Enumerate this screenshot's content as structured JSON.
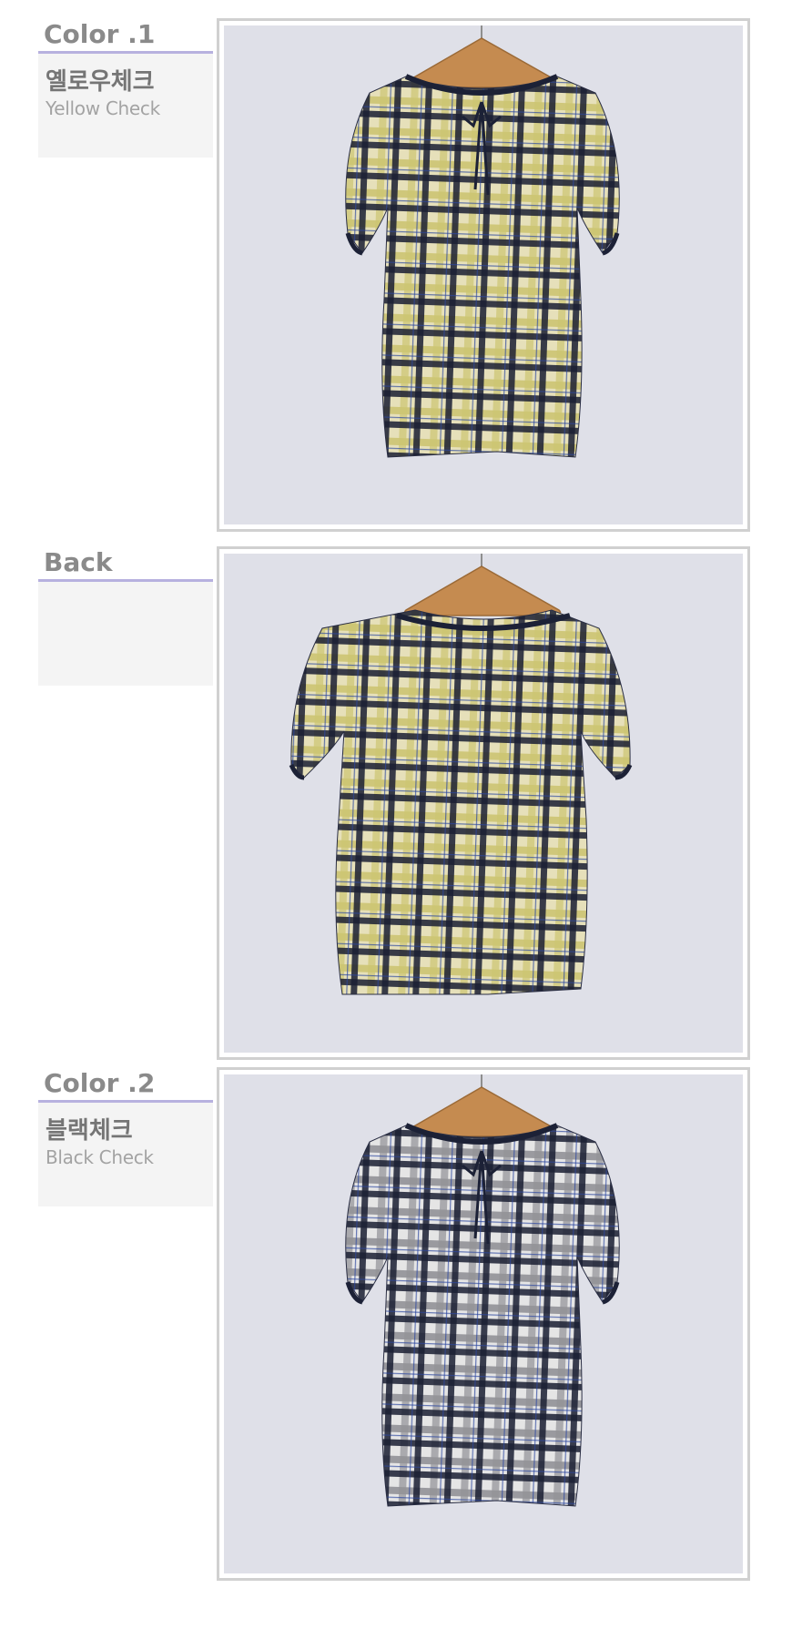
{
  "sections": [
    {
      "title": "Color .1",
      "name_ko": "옐로우체크",
      "name_en": "Yellow Check",
      "garment": "yellow-check",
      "view": "front"
    },
    {
      "title": "Back",
      "name_ko": "",
      "name_en": "",
      "garment": "yellow-check",
      "view": "back"
    },
    {
      "title": "Color .2",
      "name_ko": "블랙체크",
      "name_en": "Black Check",
      "garment": "black-check",
      "view": "front"
    }
  ],
  "colors": {
    "label_text": "#8a8a8a",
    "label_rule": "#b7b1df",
    "label_box": "#f4f4f4",
    "wall": "#dfe0e8",
    "yellow_check_base": "#f3edc4",
    "yellow_check_band": "#d9d07a",
    "black_check_base": "#f2f2f2",
    "check_dark": "#1c2136",
    "hanger_wood": "#c58b50"
  }
}
